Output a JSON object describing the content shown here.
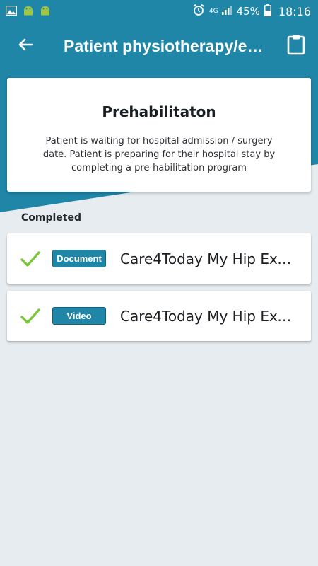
{
  "status_bar": {
    "left_icons": [
      "image-icon",
      "android-icon",
      "android-icon"
    ],
    "network_label": "4G",
    "battery_percent": "45%",
    "time": "18:16"
  },
  "app_bar": {
    "title": "Patient physiotherapy/e…",
    "back_icon": "arrow-left-icon",
    "action_icon": "clipboard-icon"
  },
  "phase": {
    "title": "Prehabilitaton",
    "description": "Patient is waiting for hospital admission / surgery date. Patient is preparing for their hospital stay by completing a pre-habilitation program"
  },
  "section": {
    "label": "Completed"
  },
  "items": [
    {
      "status_icon": "check-icon",
      "type": "Document",
      "title": "Care4Today My Hip Exe…"
    },
    {
      "status_icon": "check-icon",
      "type": "Video",
      "title": "Care4Today My Hip Exe…"
    }
  ],
  "colors": {
    "primary": "#1f86a8",
    "background": "#e6ecef",
    "check": "#7cc63a"
  }
}
